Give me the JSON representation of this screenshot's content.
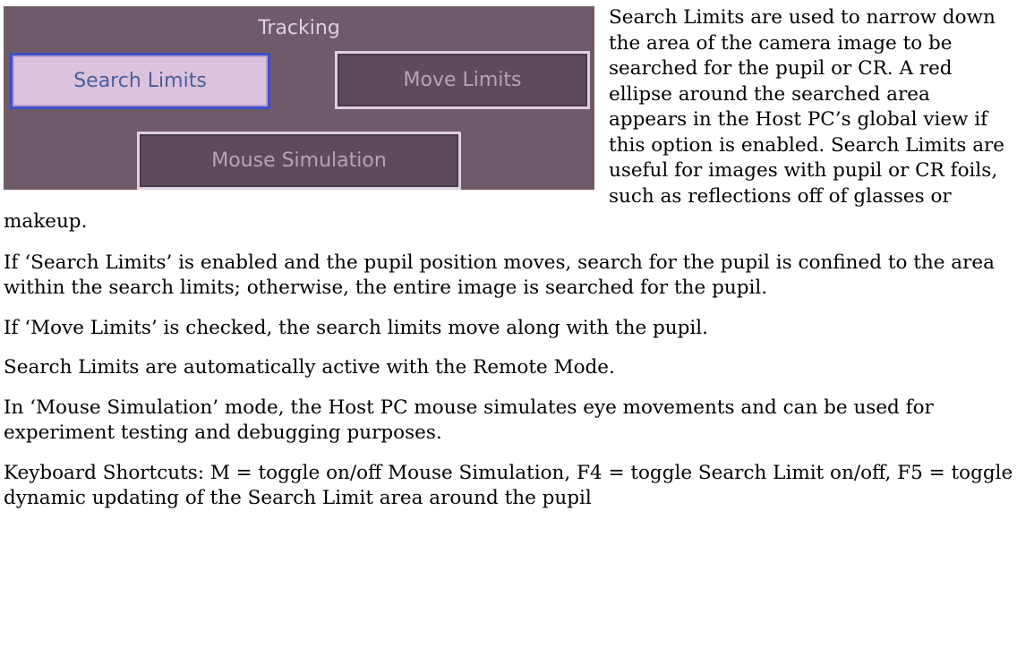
{
  "panel": {
    "title": "Tracking",
    "buttons": {
      "search_limits": "Search Limits",
      "move_limits": "Move Limits",
      "mouse_simulation": "Mouse Simulation"
    }
  },
  "paragraphs": [
    "Search Limits are used to narrow down the area of the camera image to be searched for the pupil or CR. A red ellipse around the searched area appears in the Host PC’s global view if this option is enabled. Search Limits are useful for images with pupil or CR foils, such as reflections off of glasses or makeup.",
    "If ‘Search Limits’ is enabled and the pupil position moves, search for the pupil is confined to the area within the search limits; otherwise, the entire image is searched for the pupil.",
    "If ‘Move Limits’ is checked, the search limits move along with the pupil.",
    "Search Limits are automatically active with the Remote Mode.",
    "In ‘Mouse Simulation’ mode, the Host PC mouse simulates eye movements and can be used for experiment testing and debugging purposes.",
    "Keyboard Shortcuts: M = toggle on/off Mouse Simulation, F4 = toggle Search Limit on/off, F5 = toggle dynamic updating of the Search Limit area around the pupil"
  ],
  "colors": {
    "panel_background": "#6e5a69",
    "active_button": "#dcc2dd",
    "active_border": "#3d50c7",
    "inactive_button": "#5d4b5a"
  }
}
